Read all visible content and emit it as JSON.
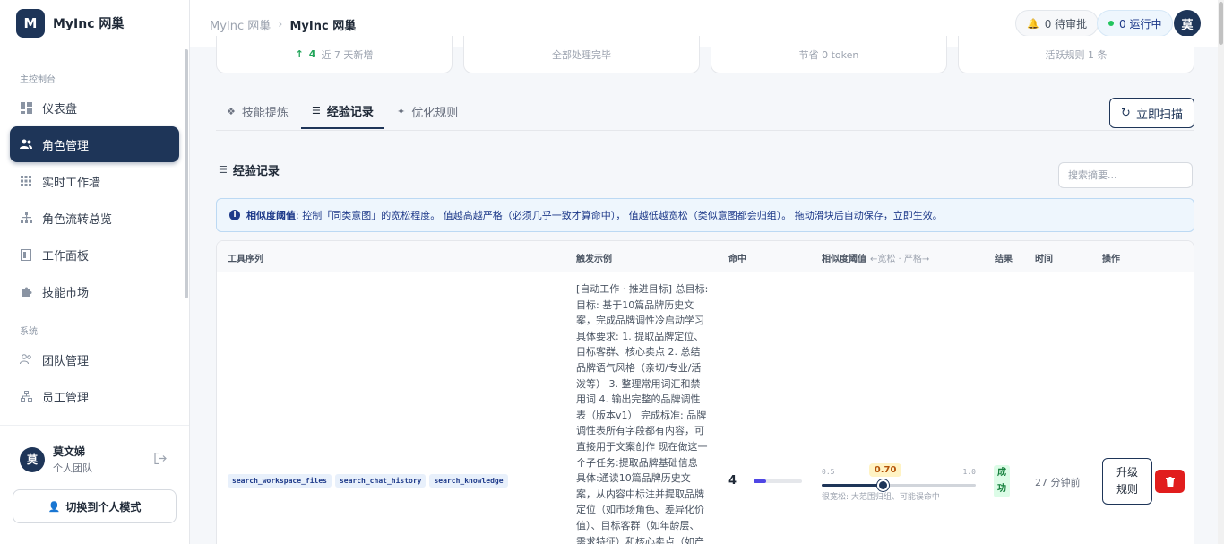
{
  "brand": {
    "logo": "M",
    "name": "MyInc 网巢"
  },
  "sidebar": {
    "sections": [
      {
        "label": "主控制台",
        "items": [
          {
            "label": "仪表盘",
            "icon": "dashboard-icon"
          },
          {
            "label": "角色管理",
            "icon": "users-icon",
            "active": true
          },
          {
            "label": "实时工作墙",
            "icon": "grid-icon"
          },
          {
            "label": "角色流转总览",
            "icon": "flow-icon"
          },
          {
            "label": "工作面板",
            "icon": "board-icon"
          },
          {
            "label": "技能市场",
            "icon": "puzzle-icon"
          }
        ]
      },
      {
        "label": "系统",
        "items": [
          {
            "label": "团队管理",
            "icon": "team-icon"
          },
          {
            "label": "员工管理",
            "icon": "org-icon"
          }
        ]
      }
    ],
    "user": {
      "avatar": "莫",
      "name": "莫文娣",
      "team": "个人团队"
    },
    "switch_label": "切换到个人模式"
  },
  "header": {
    "breadcrumb": [
      "MyInc 网巢",
      "MyInc 网巢"
    ],
    "pending": "0 待审批",
    "running": "0 运行中",
    "avatar": "莫"
  },
  "stats": [
    {
      "delta": "4",
      "text": "近 7 天新增"
    },
    {
      "text": "全部处理完毕"
    },
    {
      "text": "节省 0 token"
    },
    {
      "text": "活跃规则 1 条"
    }
  ],
  "tabs": [
    {
      "label": "技能提炼",
      "icon": "puzzle-icon"
    },
    {
      "label": "经验记录",
      "icon": "notes-icon",
      "active": true
    },
    {
      "label": "优化规则",
      "icon": "sparkle-icon"
    }
  ],
  "scan_label": "立即扫描",
  "section_title": "经验记录",
  "search": {
    "placeholder": "搜索摘要...",
    "value": ""
  },
  "notice": {
    "title": "相似度阈值",
    "text": ": 控制「同类意图」的宽松程度。 值越高越严格（必须几乎一致才算命中）， 值越低越宽松（类似意图都会归组）。 拖动滑块后自动保存，立即生效。"
  },
  "table": {
    "columns": {
      "tools": "工具序列",
      "trigger": "触发示例",
      "hits": "命中",
      "threshold": "相似度阈值",
      "threshold_hint": "←宽松 · 严格→",
      "result": "结果",
      "time": "时间",
      "actions": "操作"
    },
    "rows": [
      {
        "tools": [
          "search_workspace_files",
          "search_chat_history",
          "search_knowledge"
        ],
        "trigger": "[自动工作 · 推进目标] 总目标: 目标: 基于10篇品牌历史文案，完成品牌调性冷启动学习 具体要求: 1. 提取品牌定位、目标客群、核心卖点 2. 总结品牌语气风格（亲切/专业/活泼等） 3. 整理常用词汇和禁用词 4. 输出完整的品牌调性表（版本v1） 完成标准: 品牌调性表所有字段都有内容，可直接用于文案创作 现在做这一个子任务:提取品牌基础信息 具体:通读10篇品牌历史文案，从内容中标注并提取品牌定位（如市场角色、差异化价值）、目标客群（如年龄层、需求特征）和核心卖点（如产品特色、功",
        "hits": "4",
        "hit_ratio": 0.25,
        "threshold": {
          "min": "0.5",
          "max": "1.0",
          "value": 0.7,
          "display": "0.70",
          "desc": "很宽松: 大范围归组、可能误命中"
        },
        "result": "成功",
        "time": "27 分钟前",
        "upgrade": "升级规则"
      }
    ]
  },
  "colors": {
    "primary": "#1e3558",
    "success": "#22c55e",
    "danger": "#e11d1d",
    "info_bg": "#eef6fd"
  }
}
